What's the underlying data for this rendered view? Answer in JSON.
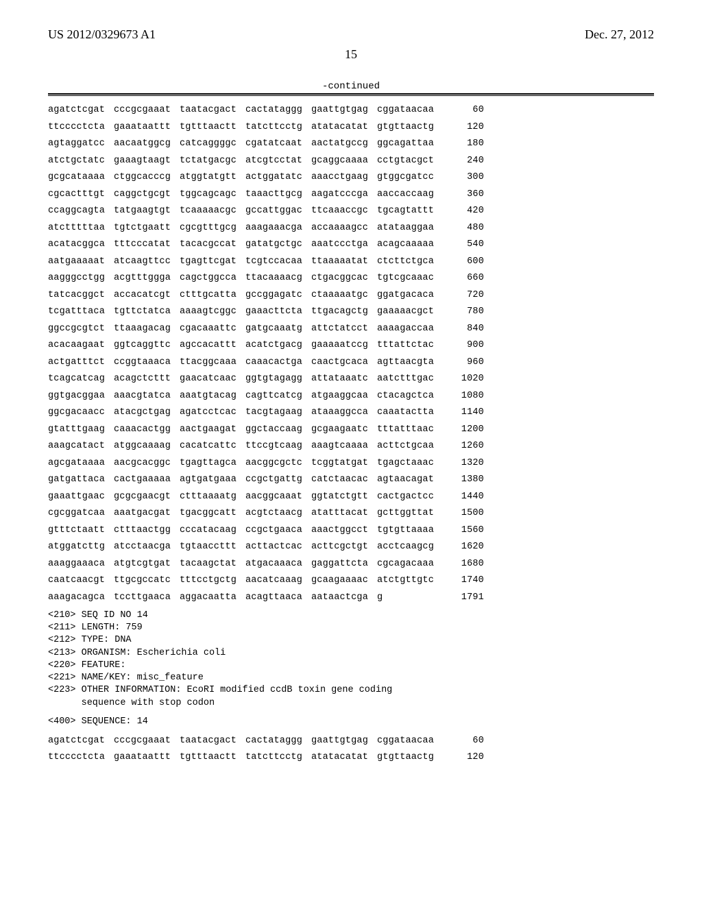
{
  "header": {
    "left": "US 2012/0329673 A1",
    "right": "Dec. 27, 2012"
  },
  "page_number": "15",
  "continued_label": "-continued",
  "sequence13": {
    "rows": [
      {
        "groups": [
          "agatctcgat",
          "cccgcgaaat",
          "taatacgact",
          "cactataggg",
          "gaattgtgag",
          "cggataacaa"
        ],
        "pos": "60"
      },
      {
        "groups": [
          "ttcccctcta",
          "gaaataattt",
          "tgtttaactt",
          "tatcttcctg",
          "atatacatat",
          "gtgttaactg"
        ],
        "pos": "120"
      },
      {
        "groups": [
          "agtaggatcc",
          "aacaatggcg",
          "catcaggggc",
          "cgatatcaat",
          "aactatgccg",
          "ggcagattaa"
        ],
        "pos": "180"
      },
      {
        "groups": [
          "atctgctatc",
          "gaaagtaagt",
          "tctatgacgc",
          "atcgtcctat",
          "gcaggcaaaa",
          "cctgtacgct"
        ],
        "pos": "240"
      },
      {
        "groups": [
          "gcgcataaaa",
          "ctggcacccg",
          "atggtatgtt",
          "actggatatc",
          "aaacctgaag",
          "gtggcgatcc"
        ],
        "pos": "300"
      },
      {
        "groups": [
          "cgcactttgt",
          "caggctgcgt",
          "tggcagcagc",
          "taaacttgcg",
          "aagatcccga",
          "aaccaccaag"
        ],
        "pos": "360"
      },
      {
        "groups": [
          "ccaggcagta",
          "tatgaagtgt",
          "tcaaaaacgc",
          "gccattggac",
          "ttcaaaccgc",
          "tgcagtattt"
        ],
        "pos": "420"
      },
      {
        "groups": [
          "atctttttaa",
          "tgtctgaatt",
          "cgcgtttgcg",
          "aaagaaacga",
          "accaaaagcc",
          "atataaggaa"
        ],
        "pos": "480"
      },
      {
        "groups": [
          "acatacggca",
          "tttcccatat",
          "tacacgccat",
          "gatatgctgc",
          "aaatccctga",
          "acagcaaaaa"
        ],
        "pos": "540"
      },
      {
        "groups": [
          "aatgaaaaat",
          "atcaagttcc",
          "tgagttcgat",
          "tcgtccacaa",
          "ttaaaaatat",
          "ctcttctgca"
        ],
        "pos": "600"
      },
      {
        "groups": [
          "aagggcctgg",
          "acgtttggga",
          "cagctggcca",
          "ttacaaaacg",
          "ctgacggcac",
          "tgtcgcaaac"
        ],
        "pos": "660"
      },
      {
        "groups": [
          "tatcacggct",
          "accacatcgt",
          "ctttgcatta",
          "gccggagatc",
          "ctaaaaatgc",
          "ggatgacaca"
        ],
        "pos": "720"
      },
      {
        "groups": [
          "tcgatttaca",
          "tgttctatca",
          "aaaagtcggc",
          "gaaacttcta",
          "ttgacagctg",
          "gaaaaacgct"
        ],
        "pos": "780"
      },
      {
        "groups": [
          "ggccgcgtct",
          "ttaaagacag",
          "cgacaaattc",
          "gatgcaaatg",
          "attctatcct",
          "aaaagaccaa"
        ],
        "pos": "840"
      },
      {
        "groups": [
          "acacaagaat",
          "ggtcaggttc",
          "agccacattt",
          "acatctgacg",
          "gaaaaatccg",
          "tttattctac"
        ],
        "pos": "900"
      },
      {
        "groups": [
          "actgatttct",
          "ccggtaaaca",
          "ttacggcaaa",
          "caaacactga",
          "caactgcaca",
          "agttaacgta"
        ],
        "pos": "960"
      },
      {
        "groups": [
          "tcagcatcag",
          "acagctcttt",
          "gaacatcaac",
          "ggtgtagagg",
          "attataaatc",
          "aatctttgac"
        ],
        "pos": "1020"
      },
      {
        "groups": [
          "ggtgacggaa",
          "aaacgtatca",
          "aaatgtacag",
          "cagttcatcg",
          "atgaaggcaa",
          "ctacagctca"
        ],
        "pos": "1080"
      },
      {
        "groups": [
          "ggcgacaacc",
          "atacgctgag",
          "agatcctcac",
          "tacgtagaag",
          "ataaaggcca",
          "caaatactta"
        ],
        "pos": "1140"
      },
      {
        "groups": [
          "gtatttgaag",
          "caaacactgg",
          "aactgaagat",
          "ggctaccaag",
          "gcgaagaatc",
          "tttatttaac"
        ],
        "pos": "1200"
      },
      {
        "groups": [
          "aaagcatact",
          "atggcaaaag",
          "cacatcattc",
          "ttccgtcaag",
          "aaagtcaaaa",
          "acttctgcaa"
        ],
        "pos": "1260"
      },
      {
        "groups": [
          "agcgataaaa",
          "aacgcacggc",
          "tgagttagca",
          "aacggcgctc",
          "tcggtatgat",
          "tgagctaaac"
        ],
        "pos": "1320"
      },
      {
        "groups": [
          "gatgattaca",
          "cactgaaaaa",
          "agtgatgaaa",
          "ccgctgattg",
          "catctaacac",
          "agtaacagat"
        ],
        "pos": "1380"
      },
      {
        "groups": [
          "gaaattgaac",
          "gcgcgaacgt",
          "ctttaaaatg",
          "aacggcaaat",
          "ggtatctgtt",
          "cactgactcc"
        ],
        "pos": "1440"
      },
      {
        "groups": [
          "cgcggatcaa",
          "aaatgacgat",
          "tgacggcatt",
          "acgtctaacg",
          "atatttacat",
          "gcttggttat"
        ],
        "pos": "1500"
      },
      {
        "groups": [
          "gtttctaatt",
          "ctttaactgg",
          "cccatacaag",
          "ccgctgaaca",
          "aaactggcct",
          "tgtgttaaaa"
        ],
        "pos": "1560"
      },
      {
        "groups": [
          "atggatcttg",
          "atcctaacga",
          "tgtaaccttt",
          "acttactcac",
          "acttcgctgt",
          "acctcaagcg"
        ],
        "pos": "1620"
      },
      {
        "groups": [
          "aaaggaaaca",
          "atgtcgtgat",
          "tacaagctat",
          "atgacaaaca",
          "gaggattcta",
          "cgcagacaaa"
        ],
        "pos": "1680"
      },
      {
        "groups": [
          "caatcaacgt",
          "ttgcgccatc",
          "tttcctgctg",
          "aacatcaaag",
          "gcaagaaaac",
          "atctgttgtc"
        ],
        "pos": "1740"
      },
      {
        "groups": [
          "aaagacagca",
          "tccttgaaca",
          "aggacaatta",
          "acagttaaca",
          "aataactcga",
          "g"
        ],
        "pos": "1791"
      }
    ]
  },
  "seq14_meta": [
    "<210> SEQ ID NO 14",
    "<211> LENGTH: 759",
    "<212> TYPE: DNA",
    "<213> ORGANISM: Escherichia coli",
    "<220> FEATURE:",
    "<221> NAME/KEY: misc_feature",
    "<223> OTHER INFORMATION: EcoRI modified ccdB toxin gene coding",
    "      sequence with stop codon"
  ],
  "seq14_header": "<400> SEQUENCE: 14",
  "sequence14": {
    "rows": [
      {
        "groups": [
          "agatctcgat",
          "cccgcgaaat",
          "taatacgact",
          "cactataggg",
          "gaattgtgag",
          "cggataacaa"
        ],
        "pos": "60"
      },
      {
        "groups": [
          "ttcccctcta",
          "gaaataattt",
          "tgtttaactt",
          "tatcttcctg",
          "atatacatat",
          "gtgttaactg"
        ],
        "pos": "120"
      }
    ]
  }
}
